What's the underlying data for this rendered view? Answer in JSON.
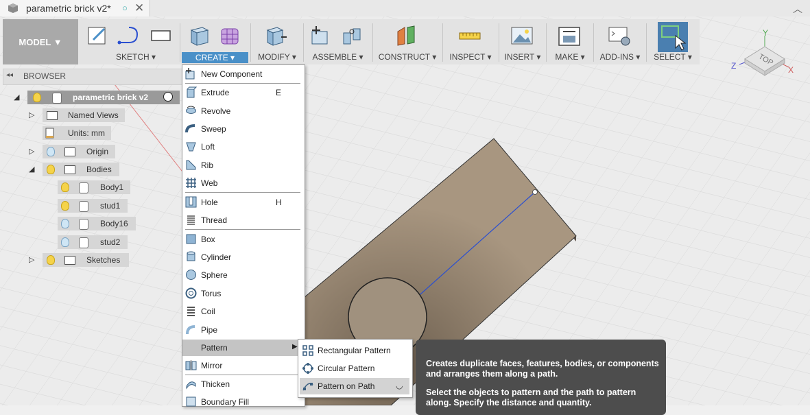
{
  "window": {
    "doc_title": "parametric brick v2*",
    "close_glyph": "✕",
    "tab_status_glyph": "○"
  },
  "toolbar": {
    "model": "MODEL ▼",
    "groups": [
      {
        "label": "SKETCH ▾"
      },
      {
        "label": "CREATE ▾"
      },
      {
        "label": "MODIFY ▾"
      },
      {
        "label": "ASSEMBLE ▾"
      },
      {
        "label": "CONSTRUCT ▾"
      },
      {
        "label": "INSPECT ▾"
      },
      {
        "label": "INSERT ▾"
      },
      {
        "label": "MAKE ▾"
      },
      {
        "label": "ADD-INS ▾"
      },
      {
        "label": "SELECT ▾"
      }
    ]
  },
  "browser": {
    "title": "BROWSER",
    "collapse_glyph": "◂◂",
    "root": "parametric brick v2",
    "items": [
      {
        "label": "Named Views"
      },
      {
        "label": "Units: mm"
      },
      {
        "label": "Origin"
      },
      {
        "label": "Bodies"
      },
      {
        "label": "Body1"
      },
      {
        "label": "stud1"
      },
      {
        "label": "Body16"
      },
      {
        "label": "stud2"
      },
      {
        "label": "Sketches"
      }
    ]
  },
  "create_menu": {
    "items": [
      {
        "label": "New Component",
        "key": ""
      },
      {
        "label": "Extrude",
        "key": "E"
      },
      {
        "label": "Revolve",
        "key": ""
      },
      {
        "label": "Sweep",
        "key": ""
      },
      {
        "label": "Loft",
        "key": ""
      },
      {
        "label": "Rib",
        "key": ""
      },
      {
        "label": "Web",
        "key": ""
      },
      {
        "label": "Hole",
        "key": "H"
      },
      {
        "label": "Thread",
        "key": ""
      },
      {
        "label": "Box",
        "key": ""
      },
      {
        "label": "Cylinder",
        "key": ""
      },
      {
        "label": "Sphere",
        "key": ""
      },
      {
        "label": "Torus",
        "key": ""
      },
      {
        "label": "Coil",
        "key": ""
      },
      {
        "label": "Pipe",
        "key": ""
      },
      {
        "label": "Pattern",
        "key": ""
      },
      {
        "label": "Mirror",
        "key": ""
      },
      {
        "label": "Thicken",
        "key": ""
      },
      {
        "label": "Boundary Fill",
        "key": ""
      }
    ]
  },
  "pattern_submenu": {
    "items": [
      {
        "label": "Rectangular Pattern"
      },
      {
        "label": "Circular Pattern"
      },
      {
        "label": "Pattern on Path"
      }
    ]
  },
  "tooltip": {
    "line1": "Creates duplicate faces, features, bodies, or components and arranges them along a path.",
    "line2": "Select the objects to pattern and the path to pattern along. Specify the distance and quantity."
  },
  "viewcube": {
    "face": "TOP",
    "x": "X",
    "y": "Y",
    "z": "Z"
  },
  "colors": {
    "accent": "#4a90c8",
    "brick": "#a5927a",
    "tooltip_bg": "#4d4d4d"
  }
}
